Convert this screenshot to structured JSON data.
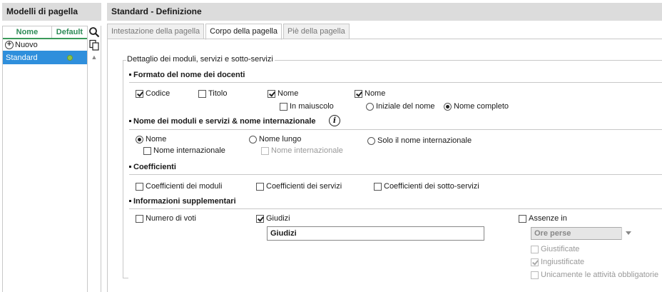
{
  "left_panel": {
    "title": "Modelli di pagella",
    "columns": {
      "nome": "Nome",
      "default": "Default"
    },
    "new_label": "Nuovo",
    "rows": [
      {
        "name": "Standard",
        "default": true
      }
    ]
  },
  "right_panel": {
    "title": "Standard - Definizione",
    "tabs": [
      {
        "label": "Intestazione della pagella",
        "active": false
      },
      {
        "label": "Corpo della pagella",
        "active": true
      },
      {
        "label": "Piè della pagella",
        "active": false
      }
    ],
    "fieldset_legend": "Dettaglio dei moduli, servizi e sotto-servizi",
    "formato": {
      "title": "Formato del nome dei docenti",
      "codice": "Codice",
      "titolo": "Titolo",
      "nome1": "Nome",
      "nome2": "Nome",
      "in_maiuscolo": "In maiuscolo",
      "iniziale": "Iniziale del nome",
      "completo": "Nome completo"
    },
    "nome_moduli": {
      "title": "Nome dei moduli e servizi & nome internazionale",
      "nome": "Nome",
      "nome_lungo": "Nome lungo",
      "solo_int": "Solo il nome internazionale",
      "nome_int_1": "Nome internazionale",
      "nome_int_2": "Nome internazionale"
    },
    "coefficienti": {
      "title": "Coefficienti",
      "moduli": "Coefficienti dei moduli",
      "servizi": "Coefficienti dei servizi",
      "sotto_servizi": "Coefficienti dei sotto-servizi"
    },
    "informazioni": {
      "title": "Informazioni supplementari",
      "numero_voti": "Numero di voti",
      "giudizi": "Giudizi",
      "giudizi_value": "Giudizi",
      "assenze": "Assenze in",
      "ore_perse": "Ore perse",
      "giustificate": "Giustificate",
      "ingiustificate": "Ingiustificate",
      "obbligatorie": "Unicamente le attività obbligatorie"
    }
  },
  "colors": {
    "header_bg": "#dcdcdc",
    "selection": "#2f8fdc",
    "column_header": "#2e8b57",
    "default_dot": "#8bc34a"
  }
}
